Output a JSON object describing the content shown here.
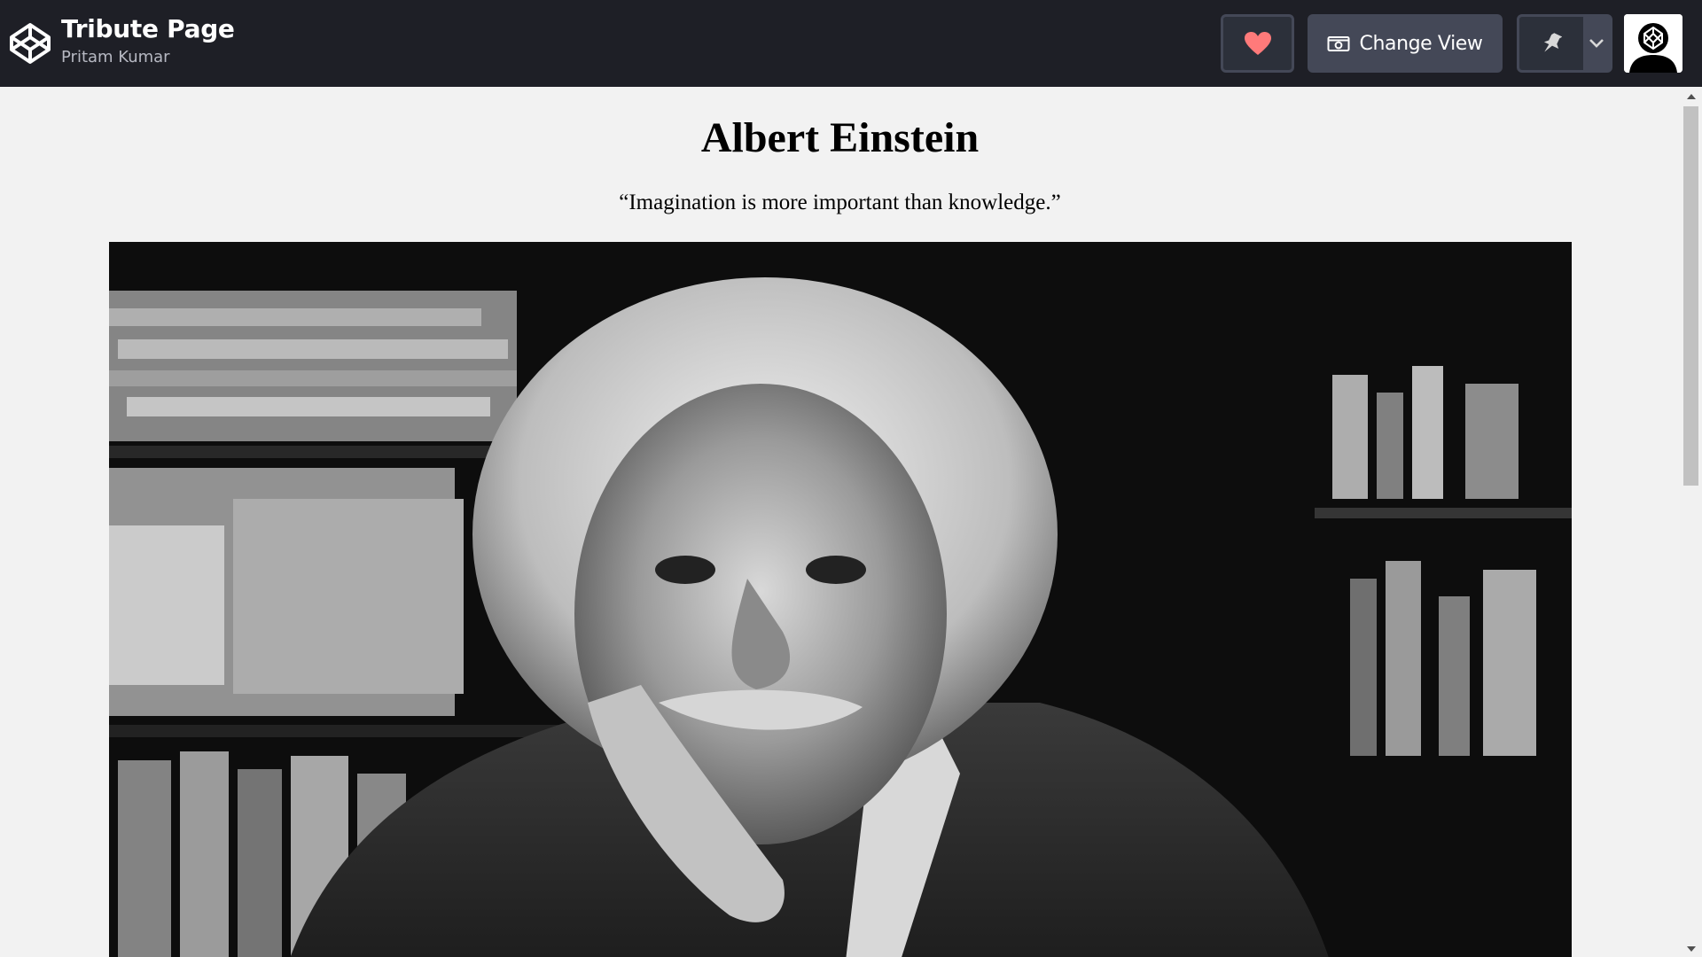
{
  "header": {
    "title": "Tribute Page",
    "author": "Pritam Kumar",
    "change_view_label": "Change View"
  },
  "icons": {
    "logo": "codepen-logo-icon",
    "heart": "heart-icon",
    "change_view": "eye-view-icon",
    "pin": "pin-icon",
    "chevron": "chevron-down-icon",
    "avatar": "user-avatar"
  },
  "colors": {
    "topbar": "#1e1f26",
    "heart": "#ff6b6b",
    "button": "#444857",
    "preview_bg": "#f2f2f2"
  },
  "tribute": {
    "heading": "Albert Einstein",
    "quote": "“Imagination is more important than knowledge.”"
  }
}
